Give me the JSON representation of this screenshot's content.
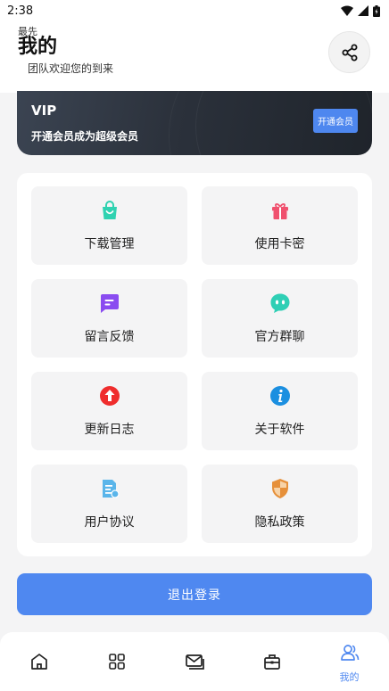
{
  "status_bar": {
    "time": "2:38"
  },
  "header": {
    "tiny_text": "最先",
    "title": "我的",
    "subtitle": "团队欢迎您的到来",
    "share_icon": "share-icon"
  },
  "vip": {
    "title": "VIP",
    "description": "开通会员成为超级会员",
    "button_label": "开通会员"
  },
  "menu": {
    "items": [
      {
        "label": "下载管理",
        "icon": "shopping-bag-icon",
        "color": "#2fd2b1"
      },
      {
        "label": "使用卡密",
        "icon": "gift-icon",
        "color": "#f0506e"
      },
      {
        "label": "留言反馈",
        "icon": "message-icon",
        "color": "#8a4cf0"
      },
      {
        "label": "官方群聊",
        "icon": "chat-bubble-icon",
        "color": "#2fcfb5"
      },
      {
        "label": "更新日志",
        "icon": "upload-arrow-icon",
        "color": "#ef2d2d"
      },
      {
        "label": "关于软件",
        "icon": "info-icon",
        "color": "#1b8fe0"
      },
      {
        "label": "用户协议",
        "icon": "document-icon",
        "color": "#5ab5ea"
      },
      {
        "label": "隐私政策",
        "icon": "shield-icon",
        "color": "#e6903a"
      }
    ]
  },
  "logout_label": "退出登录",
  "tabbar": {
    "tabs": [
      {
        "icon": "home-icon"
      },
      {
        "icon": "grid-icon"
      },
      {
        "icon": "mail-icon"
      },
      {
        "icon": "briefcase-icon"
      },
      {
        "icon": "users-icon",
        "label": "我的",
        "active": true
      }
    ],
    "accent": "#4f88f0"
  }
}
